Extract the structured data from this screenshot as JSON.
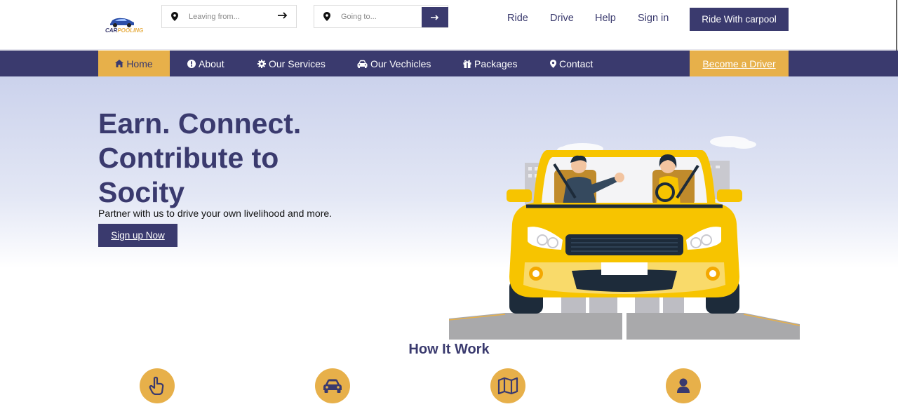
{
  "logo": {
    "text_a": "CAR",
    "text_b": "POOLING"
  },
  "search": {
    "from_placeholder": "Leaving from...",
    "to_placeholder": "Going to..."
  },
  "toplinks": {
    "ride": "Ride",
    "drive": "Drive",
    "help": "Help",
    "signin": "Sign in"
  },
  "cta_top": "Ride With carpool",
  "nav": {
    "home": "Home",
    "about": "About",
    "services": "Our Services",
    "vehicles": "Our Vechicles",
    "packages": "Packages",
    "contact": "Contact",
    "driver": "Become a Driver"
  },
  "hero": {
    "title": "Earn. Connect. Contribute to Socity",
    "subtitle": "Partner with us to drive your own livelihood and more.",
    "button": "Sign up Now"
  },
  "how": {
    "title": "How It Work",
    "steps": [
      {
        "icon": "hand-pointer-icon"
      },
      {
        "icon": "car-icon"
      },
      {
        "icon": "map-icon"
      },
      {
        "icon": "user-icon"
      }
    ]
  },
  "colors": {
    "primary": "#3a3a6e",
    "accent": "#e7b04a",
    "car": "#f7c400"
  }
}
